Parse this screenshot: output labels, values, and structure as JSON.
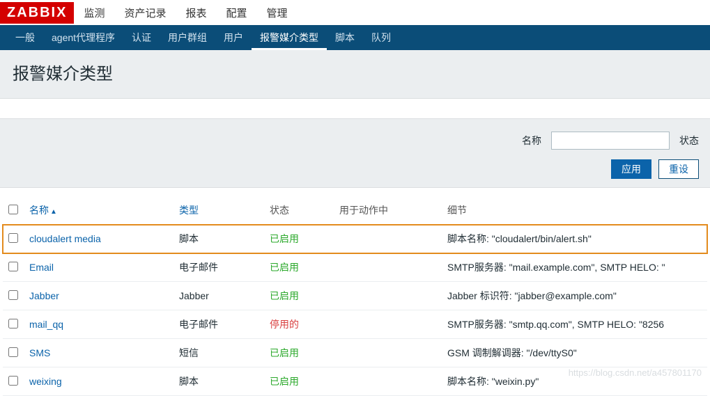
{
  "logo": "ZABBIX",
  "topnav": {
    "items": [
      {
        "label": "监测"
      },
      {
        "label": "资产记录"
      },
      {
        "label": "报表"
      },
      {
        "label": "配置"
      },
      {
        "label": "管理",
        "active": true
      }
    ]
  },
  "subnav": {
    "items": [
      {
        "label": "一般"
      },
      {
        "label": "agent代理程序"
      },
      {
        "label": "认证"
      },
      {
        "label": "用户群组"
      },
      {
        "label": "用户"
      },
      {
        "label": "报警媒介类型",
        "active": true
      },
      {
        "label": "脚本"
      },
      {
        "label": "队列"
      }
    ]
  },
  "page_title": "报警媒介类型",
  "filter": {
    "name_label": "名称",
    "name_value": "",
    "status_label": "状态",
    "apply_btn": "应用",
    "reset_btn": "重设"
  },
  "table": {
    "columns": {
      "name": "名称",
      "type": "类型",
      "status": "状态",
      "used_in": "用于动作中",
      "details": "细节"
    },
    "sort_indicator": "▲",
    "rows": [
      {
        "name": "cloudalert media",
        "type": "脚本",
        "status": "已启用",
        "status_class": "status-enabled",
        "used_in": "",
        "details": "脚本名称: \"cloudalert/bin/alert.sh\"",
        "highlight": true
      },
      {
        "name": "Email",
        "type": "电子邮件",
        "status": "已启用",
        "status_class": "status-enabled",
        "used_in": "",
        "details": "SMTP服务器: \"mail.example.com\", SMTP HELO: \""
      },
      {
        "name": "Jabber",
        "type": "Jabber",
        "status": "已启用",
        "status_class": "status-enabled",
        "used_in": "",
        "details": "Jabber 标识符: \"jabber@example.com\""
      },
      {
        "name": "mail_qq",
        "type": "电子邮件",
        "status": "停用的",
        "status_class": "status-disabled",
        "used_in": "",
        "details": "SMTP服务器: \"smtp.qq.com\", SMTP HELO: \"8256"
      },
      {
        "name": "SMS",
        "type": "短信",
        "status": "已启用",
        "status_class": "status-enabled",
        "used_in": "",
        "details": "GSM 调制解调器: \"/dev/ttyS0\""
      },
      {
        "name": "weixing",
        "type": "脚本",
        "status": "已启用",
        "status_class": "status-enabled",
        "used_in": "",
        "details": "脚本名称: \"weixin.py\""
      }
    ]
  },
  "watermark": "https://blog.csdn.net/a457801170"
}
